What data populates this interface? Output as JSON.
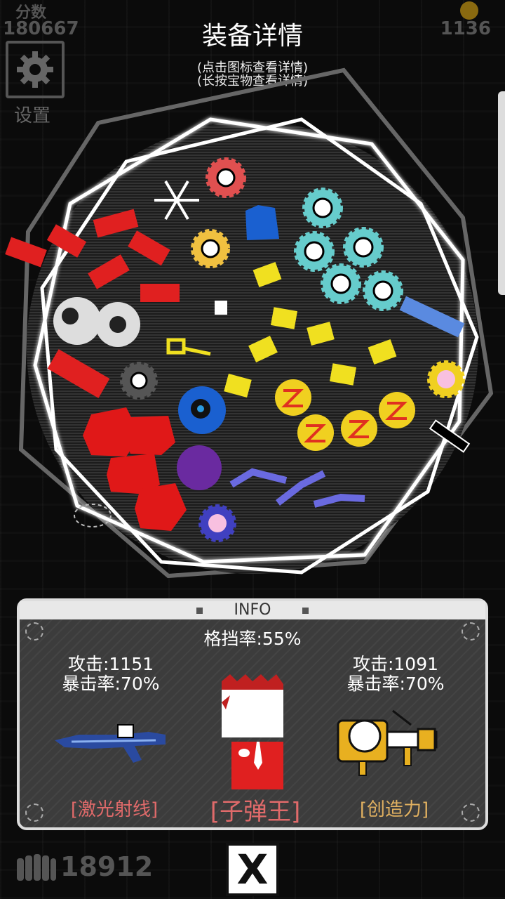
{
  "hud": {
    "score_label": "分数",
    "score_value": "180667",
    "coins": "1136",
    "settings_label": "设置",
    "bullet_count": "18912"
  },
  "header": {
    "title": "装备详情",
    "hint_tap": "(点击图标查看详情)",
    "hint_hold": "(长按宝物查看详情)"
  },
  "info": {
    "header": "INFO",
    "block_rate": "格挡率:55%",
    "left_weapon": {
      "attack": "攻击:1151",
      "crit": "暴击率:70%",
      "name": "[激光射线]"
    },
    "character_name": "[子弹王]",
    "right_weapon": {
      "attack": "攻击:1091",
      "crit": "暴击率:70%",
      "name": "[创造力]"
    }
  },
  "close_label": "X",
  "colors": {
    "accent_red": "#e06a6a",
    "accent_gold": "#e0b060",
    "panel_bg": "#3c3c3c"
  }
}
